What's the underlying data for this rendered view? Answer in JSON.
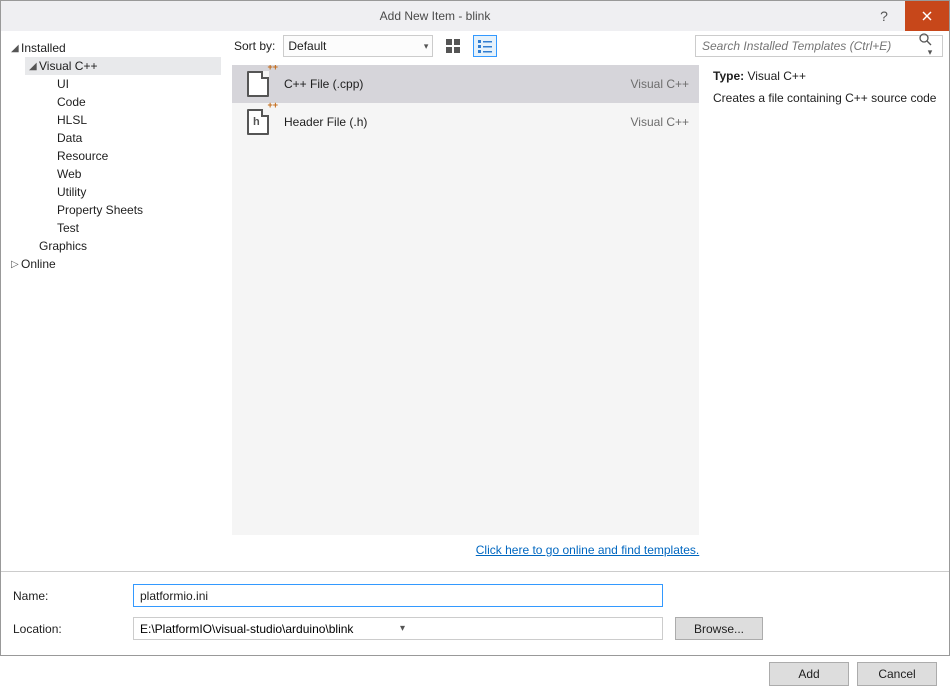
{
  "title": "Add New Item - blink",
  "sidebar": {
    "installed": "Installed",
    "vcpp": "Visual C++",
    "items": [
      "UI",
      "Code",
      "HLSL",
      "Data",
      "Resource",
      "Web",
      "Utility",
      "Property Sheets",
      "Test"
    ],
    "graphics": "Graphics",
    "online": "Online"
  },
  "sort": {
    "label": "Sort by:",
    "value": "Default"
  },
  "search": {
    "placeholder": "Search Installed Templates (Ctrl+E)"
  },
  "templates": [
    {
      "name": "C++ File (.cpp)",
      "lang": "Visual C++",
      "selected": true,
      "glyph": ""
    },
    {
      "name": "Header File (.h)",
      "lang": "Visual C++",
      "selected": false,
      "glyph": "h"
    }
  ],
  "details": {
    "typeLabel": "Type:",
    "typeValue": "Visual C++",
    "description": "Creates a file containing C++ source code"
  },
  "link": "Click here to go online and find templates.",
  "form": {
    "nameLabel": "Name:",
    "nameValue": "platformio.ini",
    "locationLabel": "Location:",
    "locationValue": "E:\\PlatformIO\\visual-studio\\arduino\\blink",
    "browse": "Browse..."
  },
  "buttons": {
    "add": "Add",
    "cancel": "Cancel"
  }
}
